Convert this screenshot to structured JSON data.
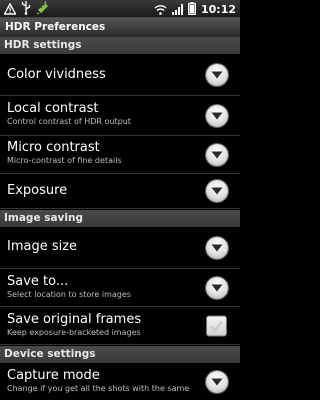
{
  "status_bar": {
    "time": "10:12",
    "icons": [
      "warning-icon",
      "usb-icon",
      "android-debug-icon",
      "wifi-icon",
      "signal-icon",
      "battery-icon"
    ]
  },
  "title": "HDR Preferences",
  "sections": [
    {
      "header": "HDR settings"
    },
    {
      "header": "Image saving"
    },
    {
      "header": "Device settings"
    }
  ],
  "items": [
    {
      "title": "Color vividness",
      "summary": "",
      "control": "dropdown"
    },
    {
      "title": "Local contrast",
      "summary": "Control contrast of HDR output",
      "control": "dropdown"
    },
    {
      "title": "Micro contrast",
      "summary": "Micro-contrast of fine details",
      "control": "dropdown"
    },
    {
      "title": "Exposure",
      "summary": "",
      "control": "dropdown"
    },
    {
      "title": "Image size",
      "summary": "",
      "control": "dropdown"
    },
    {
      "title": "Save to...",
      "summary": "Select location to store images",
      "control": "dropdown"
    },
    {
      "title": "Save original frames",
      "summary": "Keep exposure-bracketed images",
      "control": "checkbox",
      "checked": false
    },
    {
      "title": "Capture mode",
      "summary": "Change if you get all the shots with the same",
      "control": "dropdown"
    }
  ],
  "colors": {
    "background": "#000000",
    "section_bg": "#444444",
    "summary_text": "#bdbdbd",
    "android_green": "#8bc34a"
  }
}
